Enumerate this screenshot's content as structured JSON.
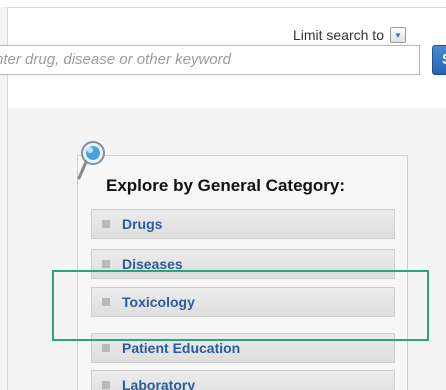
{
  "search": {
    "limit_label": "Limit search to",
    "placeholder": "nter drug, disease or other keyword",
    "button_label": "Sea"
  },
  "categories": {
    "title": "Explore by General Category:",
    "items": [
      {
        "label": "Drugs"
      },
      {
        "label": "Diseases"
      },
      {
        "label": "Toxicology"
      },
      {
        "label": "Patient Education"
      },
      {
        "label": "Laboratory"
      }
    ]
  },
  "colors": {
    "highlight": "#2aa57e",
    "link": "#2a5b9e",
    "button": "#2c6cbf"
  },
  "icons": {
    "magnifier": "magnifying-glass-icon",
    "dropdown": "chevron-down-icon"
  }
}
